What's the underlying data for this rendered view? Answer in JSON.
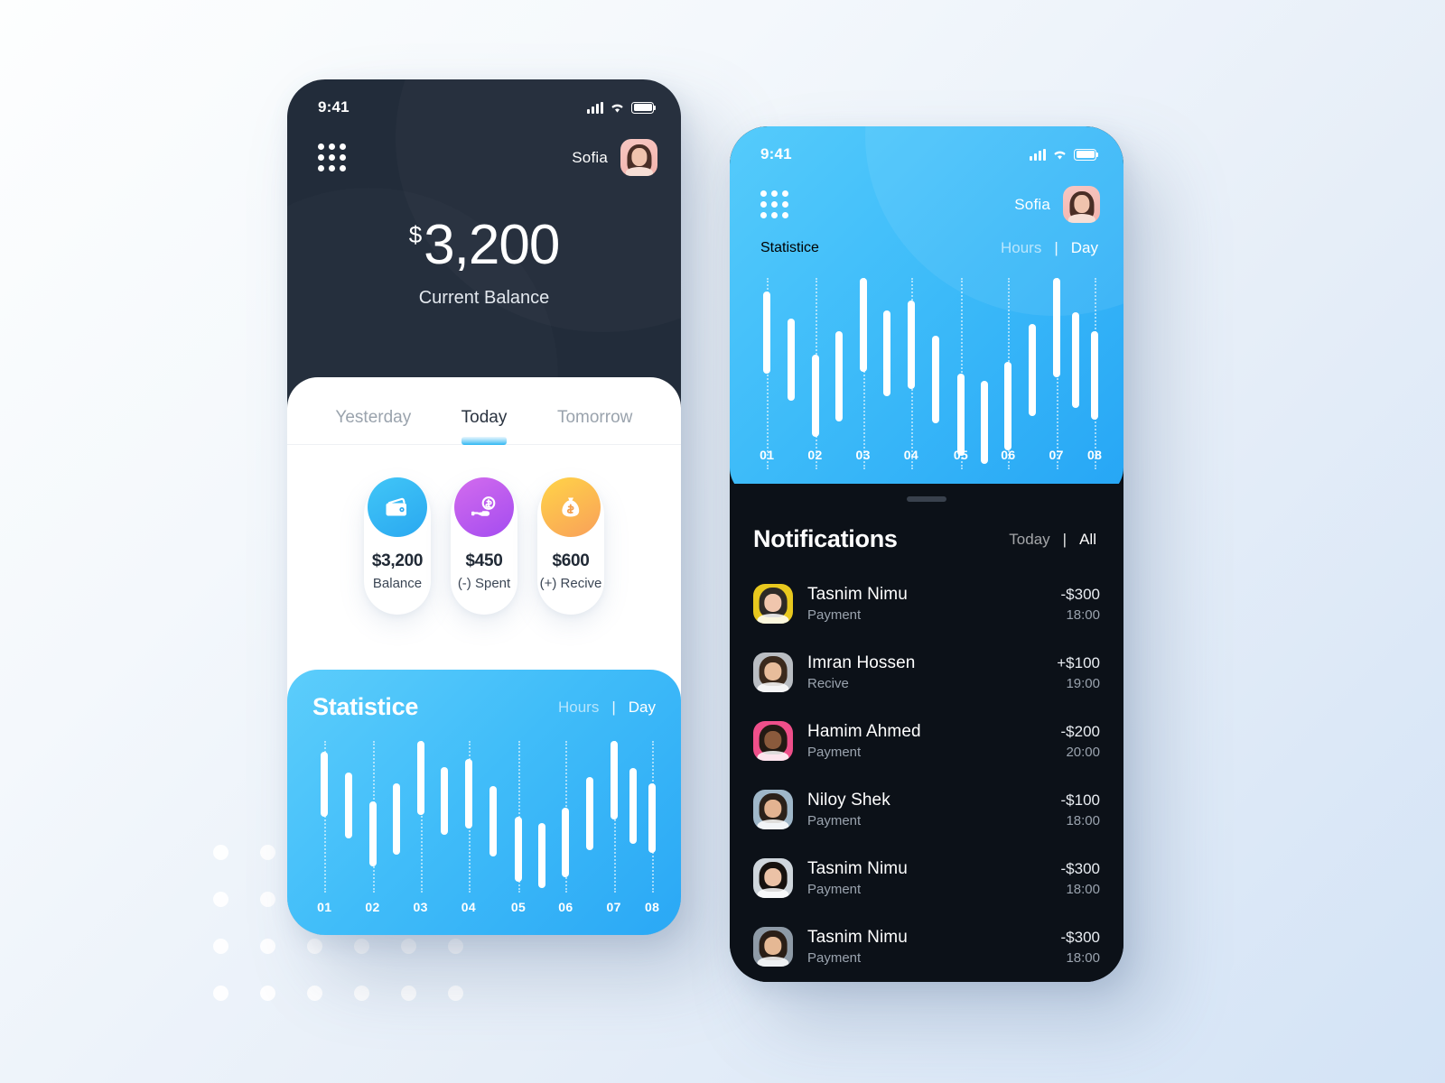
{
  "background": {
    "gradient_from": "#fdfefe",
    "gradient_to": "#d3e3f6"
  },
  "accent": {
    "blue": "#2aa8f5",
    "dark": "#222c3a",
    "black": "#0c1118",
    "purple": "#a44cf0",
    "orange": "#f9a05a"
  },
  "phone_one": {
    "status_bar": {
      "time": "9:41",
      "signal_icon": "cellular-bars-icon",
      "wifi_icon": "wifi-icon",
      "battery_icon": "battery-full-icon"
    },
    "header": {
      "menu_icon": "grid-menu-icon",
      "user_name": "Sofia",
      "avatar_icon": "user-avatar"
    },
    "hero": {
      "currency": "$",
      "amount": "3,200",
      "label": "Current Balance"
    },
    "tabs": [
      {
        "label": "Yesterday",
        "active": false
      },
      {
        "label": "Today",
        "active": true
      },
      {
        "label": "Tomorrow",
        "active": false
      }
    ],
    "cards": [
      {
        "icon": "wallet-icon",
        "value": "$3,200",
        "label": "Balance",
        "color": "#2aa8f0"
      },
      {
        "icon": "hand-coin-icon",
        "value": "$450",
        "label": "(-) Spent",
        "color": "#a44cf0"
      },
      {
        "icon": "money-bag-icon",
        "value": "$600",
        "label": "(+) Recive",
        "color": "#f9a05a"
      }
    ],
    "statistic": {
      "title": "Statistice",
      "segments": [
        {
          "label": "Hours",
          "active": false
        },
        {
          "label": "Day",
          "active": true
        }
      ],
      "separator": "|"
    }
  },
  "phone_two": {
    "status_bar": {
      "time": "9:41",
      "signal_icon": "cellular-bars-icon",
      "wifi_icon": "wifi-icon",
      "battery_icon": "battery-full-icon"
    },
    "header": {
      "menu_icon": "grid-menu-icon",
      "user_name": "Sofia",
      "avatar_icon": "user-avatar"
    },
    "statistic": {
      "title": "Statistice",
      "segments": [
        {
          "label": "Hours",
          "active": false
        },
        {
          "label": "Day",
          "active": true
        }
      ],
      "separator": "|"
    },
    "notifications": {
      "title": "Notifications",
      "segments": [
        {
          "label": "Today",
          "active": false
        },
        {
          "label": "All",
          "active": true
        }
      ],
      "separator": "|",
      "items": [
        {
          "name": "Tasnim Nimu",
          "type": "Payment",
          "amount": "-$300",
          "time": "18:00",
          "av_bg": "#e8c81e",
          "av_hair": "#2e2a26",
          "av_skin": "#f0c6ad"
        },
        {
          "name": "Imran Hossen",
          "type": "Recive",
          "amount": "+$100",
          "time": "19:00",
          "av_bg": "#b9bdc2",
          "av_hair": "#3b2a1d",
          "av_skin": "#e8bd9b"
        },
        {
          "name": "Hamim Ahmed",
          "type": "Payment",
          "amount": "-$200",
          "time": "20:00",
          "av_bg": "#ef4f8a",
          "av_hair": "#231a14",
          "av_skin": "#8a5a3c"
        },
        {
          "name": "Niloy Shek",
          "type": "Payment",
          "amount": "-$100",
          "time": "18:00",
          "av_bg": "#9fb7c9",
          "av_hair": "#2b211a",
          "av_skin": "#e3b391"
        },
        {
          "name": "Tasnim Nimu",
          "type": "Payment",
          "amount": "-$300",
          "time": "18:00",
          "av_bg": "#cfd6dc",
          "av_hair": "#16110e",
          "av_skin": "#ecc2a6"
        },
        {
          "name": "Tasnim Nimu",
          "type": "Payment",
          "amount": "-$300",
          "time": "18:00",
          "av_bg": "#8e9aa6",
          "av_hair": "#2a1e16",
          "av_skin": "#e5b894"
        }
      ]
    }
  },
  "chart_data": {
    "type": "bar",
    "title": "Statistice",
    "xlabel": "",
    "ylabel": "",
    "grid": "dotted-vertical-guides",
    "legend": "none",
    "tick_labels": [
      "01",
      "02",
      "03",
      "04",
      "05",
      "06",
      "07",
      "08"
    ],
    "note": "Floating range bars (candlestick style); values are fractions of plot height from bottom (0) to top (1).",
    "ylim": [
      0,
      1
    ],
    "bars": [
      {
        "x": 0.035,
        "low": 0.5,
        "high": 0.93
      },
      {
        "x": 0.105,
        "low": 0.36,
        "high": 0.79
      },
      {
        "x": 0.175,
        "low": 0.17,
        "high": 0.6
      },
      {
        "x": 0.245,
        "low": 0.25,
        "high": 0.72
      },
      {
        "x": 0.315,
        "low": 0.51,
        "high": 1.0
      },
      {
        "x": 0.385,
        "low": 0.38,
        "high": 0.83
      },
      {
        "x": 0.455,
        "low": 0.42,
        "high": 0.88
      },
      {
        "x": 0.525,
        "low": 0.24,
        "high": 0.7
      },
      {
        "x": 0.6,
        "low": 0.07,
        "high": 0.5
      },
      {
        "x": 0.668,
        "low": 0.03,
        "high": 0.46
      },
      {
        "x": 0.738,
        "low": 0.1,
        "high": 0.56
      },
      {
        "x": 0.808,
        "low": 0.28,
        "high": 0.76
      },
      {
        "x": 0.878,
        "low": 0.48,
        "high": 1.0
      },
      {
        "x": 0.935,
        "low": 0.32,
        "high": 0.82
      },
      {
        "x": 0.99,
        "low": 0.26,
        "high": 0.72
      }
    ],
    "guides": [
      0.035,
      0.175,
      0.315,
      0.455,
      0.6,
      0.738,
      0.878,
      0.99
    ]
  }
}
